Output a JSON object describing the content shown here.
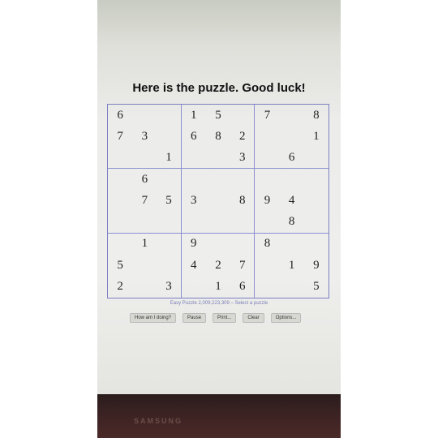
{
  "page": {
    "title": "Here is the puzzle. Good luck!",
    "puzzle_info": "Easy Puzzle 2,009,223,309 – Select a puzzle"
  },
  "grid": [
    [
      "6",
      "",
      "",
      "1",
      "5",
      "",
      "7",
      "",
      "8"
    ],
    [
      "7",
      "3",
      "",
      "6",
      "8",
      "2",
      "",
      "",
      "1"
    ],
    [
      "",
      "",
      "1",
      "",
      "",
      "3",
      "",
      "6",
      ""
    ],
    [
      "",
      "6",
      "",
      "",
      "",
      "",
      "",
      "",
      ""
    ],
    [
      "",
      "7",
      "5",
      "3",
      "",
      "8",
      "9",
      "4",
      ""
    ],
    [
      "",
      "",
      "",
      "",
      "",
      "",
      "",
      "8",
      ""
    ],
    [
      "",
      "1",
      "",
      "9",
      "",
      "",
      "8",
      "",
      ""
    ],
    [
      "5",
      "",
      "",
      "4",
      "2",
      "7",
      "",
      "1",
      "9"
    ],
    [
      "2",
      "",
      "3",
      "",
      "1",
      "6",
      "",
      "",
      "5"
    ]
  ],
  "buttons": {
    "how": "How am I doing?",
    "pause": "Pause",
    "print": "Print...",
    "clear": "Clear",
    "options": "Options..."
  },
  "monitor_brand": "SAMSUNG",
  "colors": {
    "grid_line": "#8a8fd0",
    "link": "#7a7fb8"
  }
}
